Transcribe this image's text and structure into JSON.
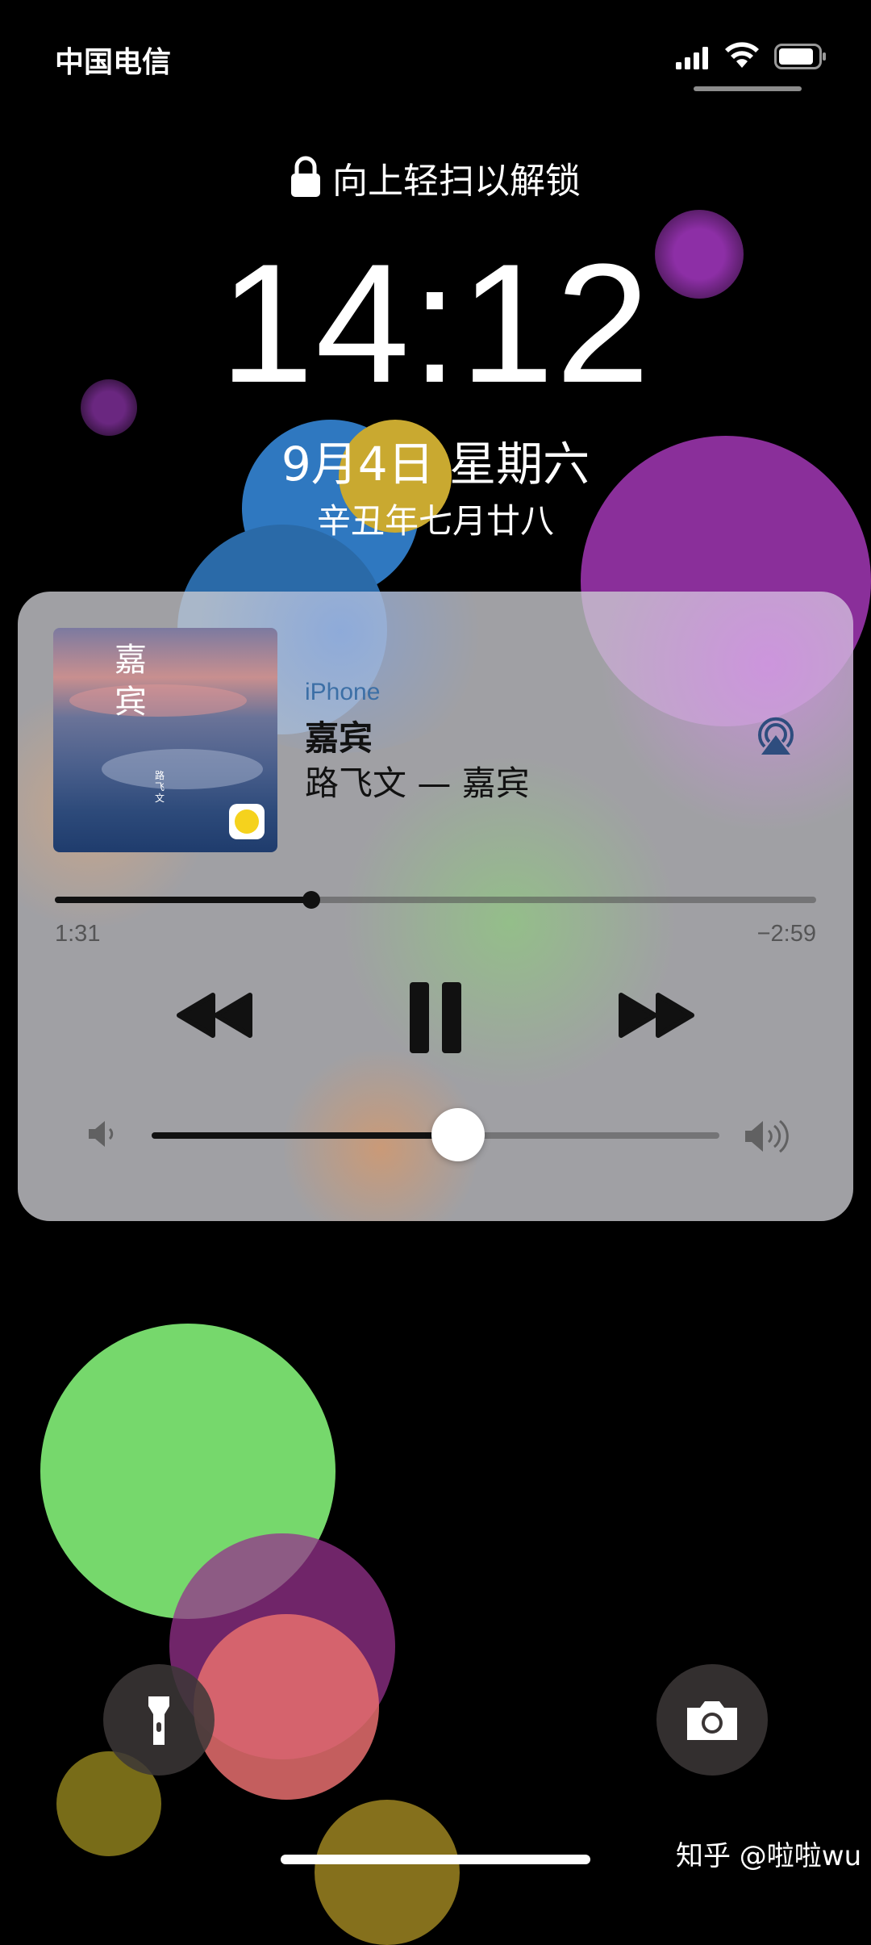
{
  "status_bar": {
    "carrier": "中国电信",
    "icons": [
      "signal-icon",
      "wifi-icon",
      "battery-icon"
    ]
  },
  "lock_screen": {
    "unlock_hint": "向上轻扫以解锁",
    "time": "14:12",
    "date": "9月4日 星期六",
    "lunar_date": "辛丑年七月廿八"
  },
  "now_playing": {
    "device": "iPhone",
    "song": "嘉宾",
    "artist_album": "路飞文 — 嘉宾",
    "album_art_title": "嘉宾",
    "album_art_artist": "路飞文",
    "app_icon": "qq-music-icon",
    "elapsed": "1:31",
    "remaining": "−2:59",
    "progress_fraction": 0.337,
    "volume_fraction": 0.54,
    "controls": [
      "rewind-icon",
      "pause-icon",
      "fast-forward-icon"
    ],
    "airplay_icon": "airplay-icon"
  },
  "bottom": {
    "flashlight_icon": "flashlight-icon",
    "camera_icon": "camera-icon",
    "watermark": "知乎 @啦啦wu"
  }
}
